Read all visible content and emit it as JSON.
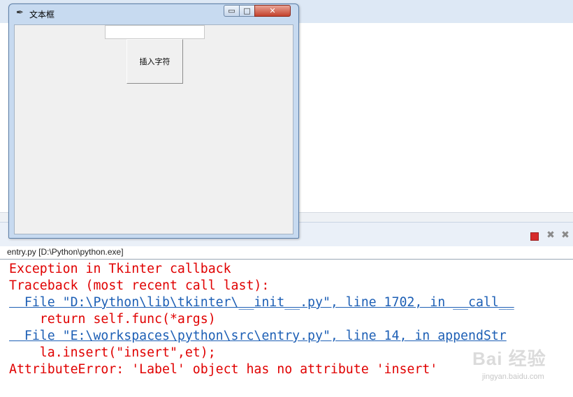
{
  "tk_window": {
    "title": "文本框",
    "app_icon": "feather-icon",
    "min_glyph": "▭",
    "max_glyph": "□",
    "close_glyph": "✕",
    "entry_value": "",
    "button_label": "插入字符"
  },
  "console": {
    "title": "entry.py [D:\\Python\\python.exe]",
    "icons": [
      "stop-icon",
      "remove-launch-icon",
      "remove-all-icon"
    ],
    "lines": [
      {
        "type": "error",
        "text": "Exception in Tkinter callback"
      },
      {
        "type": "error",
        "text": "Traceback (most recent call last):"
      },
      {
        "type": "link",
        "text": "  File \"D:\\Python\\lib\\tkinter\\__init__.py\", line 1702, in __call__"
      },
      {
        "type": "error",
        "text": "    return self.func(*args)"
      },
      {
        "type": "link",
        "text": "  File \"E:\\workspaces\\python\\src\\entry.py\", line 14, in appendStr"
      },
      {
        "type": "error",
        "text": "    la.insert(\"insert\",et);"
      },
      {
        "type": "error",
        "text": "AttributeError: 'Label' object has no attribute 'insert'"
      }
    ]
  },
  "watermark": {
    "text": "Bai 经验",
    "url": "jingyan.baidu.com"
  },
  "colors": {
    "error": "#e00000",
    "link": "#1d5fb5",
    "accent": "#c7daf0"
  }
}
